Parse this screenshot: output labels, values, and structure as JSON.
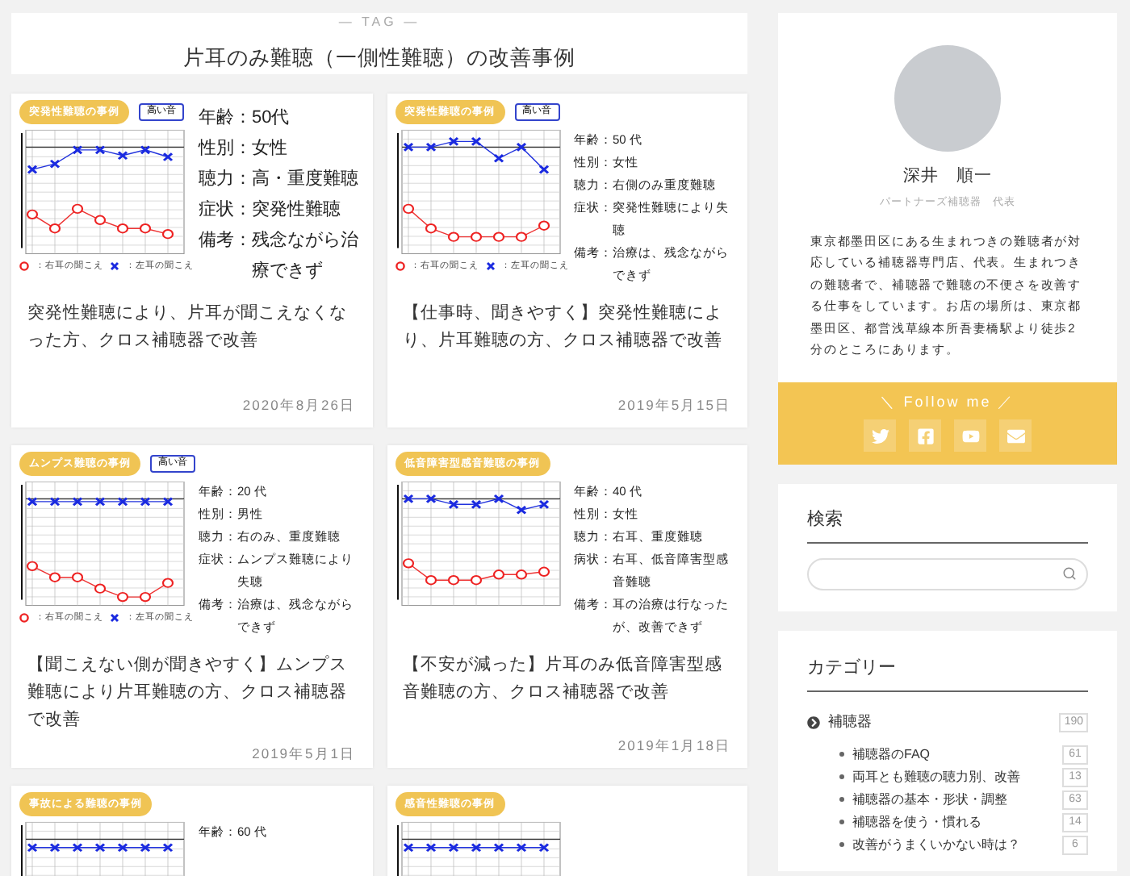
{
  "tag_header": {
    "label": "— TAG —",
    "title": "片耳のみ難聴（一側性難聴）の改善事例"
  },
  "posts": [
    {
      "thumbnail": {
        "badge": "突発性難聴の事例",
        "chip": "高い音",
        "kind": "large",
        "info": [
          {
            "label": "年齢：",
            "value": "50代"
          },
          {
            "label": "性別：",
            "value": "女性"
          },
          {
            "label": "聴力：",
            "value": "高・重度難聴"
          },
          {
            "label": "症状：",
            "value": "突発性難聴"
          },
          {
            "label": "備考：",
            "value": "残念ながら治療できず"
          }
        ],
        "legend": [
          "：右耳の聞こえ",
          "：左耳の聞こえ"
        ]
      },
      "title": "突発性難聴により、片耳が聞こえなくなった方、クロス補聴器で改善",
      "date": "2020年8月26日"
    },
    {
      "thumbnail": {
        "badge": "突発性難聴の事例",
        "chip": "高い音",
        "kind": "small",
        "info": [
          {
            "label": "年齢：",
            "value": "50 代"
          },
          {
            "label": "性別：",
            "value": "女性"
          },
          {
            "label": "聴力：",
            "value": "右側のみ重度難聴"
          },
          {
            "label": "症状：",
            "value": "突発性難聴により失聴"
          },
          {
            "label": "備考：",
            "value": "治療は、残念ながらできず"
          }
        ],
        "legend": [
          "：右耳の聞こえ",
          "：左耳の聞こえ"
        ]
      },
      "title": "【仕事時、聞きやすく】突発性難聴により、片耳難聴の方、クロス補聴器で改善",
      "date": "2019年5月15日"
    },
    {
      "thumbnail": {
        "badge": "ムンプス難聴の事例",
        "chip": "高い音",
        "kind": "small",
        "info": [
          {
            "label": "年齢：",
            "value": "20 代"
          },
          {
            "label": "性別：",
            "value": "男性"
          },
          {
            "label": "聴力：",
            "value": "右のみ、重度難聴"
          },
          {
            "label": "症状：",
            "value": "ムンプス難聴により失聴"
          },
          {
            "label": "備考：",
            "value": "治療は、残念ながらできず"
          }
        ],
        "legend": [
          "：右耳の聞こえ",
          "：左耳の聞こえ"
        ]
      },
      "title": "【聞こえない側が聞きやすく】ムンプス難聴により片耳難聴の方、クロス補聴器で改善",
      "date": "2019年5月1日"
    },
    {
      "thumbnail": {
        "badge": "低音障害型感音難聴の事例",
        "kind": "small",
        "info": [
          {
            "label": "年齢：",
            "value": "40 代"
          },
          {
            "label": "性別：",
            "value": "女性"
          },
          {
            "label": "聴力：",
            "value": "右耳、重度難聴"
          },
          {
            "label": "病状：",
            "value": "右耳、低音障害型感音難聴"
          },
          {
            "label": "備考：",
            "value": "耳の治療は行なったが、改善できず"
          }
        ]
      },
      "title": "【不安が減った】片耳のみ低音障害型感音難聴の方、クロス補聴器で改善",
      "date": "2019年1月18日"
    },
    {
      "thumbnail": {
        "badge": "事故による難聴の事例",
        "kind": "small",
        "info": [
          {
            "label": "年齢：",
            "value": "60 代"
          }
        ]
      }
    },
    {
      "thumbnail": {
        "badge": "感音性難聴の事例",
        "kind": "small"
      }
    }
  ],
  "profile": {
    "name": "深井　順一",
    "role": "パートナーズ補聴器　代表",
    "bio": "東京都墨田区にある生まれつきの難聴者が対応している補聴器専門店、代表。生まれつきの難聴者で、補聴器で難聴の不便さを改善する仕事をしています。お店の場所は、東京都墨田区、都営浅草線本所吾妻橋駅より徒歩2分のところにあります。",
    "follow_label": "＼ Follow me ／",
    "social": [
      {
        "kind": "twitter"
      },
      {
        "kind": "facebook"
      },
      {
        "kind": "youtube"
      },
      {
        "kind": "mail"
      }
    ]
  },
  "search": {
    "heading": "検索"
  },
  "categories": {
    "heading": "カテゴリー",
    "items": [
      {
        "name": "補聴器",
        "count": "190",
        "children": [
          {
            "name": "補聴器のFAQ",
            "count": "61"
          },
          {
            "name": "両耳とも難聴の聴力別、改善",
            "count": "13"
          },
          {
            "name": "補聴器の基本・形状・調整",
            "count": "63"
          },
          {
            "name": "補聴器を使う・慣れる",
            "count": "14"
          },
          {
            "name": "改善がうまくいかない時は？",
            "count": "6"
          }
        ]
      }
    ]
  }
}
